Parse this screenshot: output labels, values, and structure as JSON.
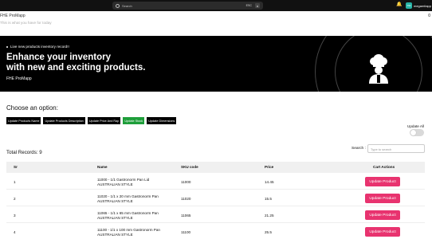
{
  "search": {
    "placeholder": "Search",
    "shortcut": "ESC",
    "clear": "x"
  },
  "user": {
    "initials": "mc",
    "name": "megamitapp"
  },
  "app": {
    "title": "FHE ProMapp",
    "subtitle": "This is what you have for today",
    "count": "0"
  },
  "banner": {
    "live": "Live new products inventory record!!",
    "headline_1": "Enhance your inventory",
    "headline_2": "with new and exciting products.",
    "brand": "FHE ProMapp"
  },
  "options": {
    "title": "Choose an option:",
    "chips": [
      "Update Products Name",
      "Update Products Description",
      "Update Price And Rap",
      "Update Stock",
      "Update Dimensions"
    ],
    "active": 3
  },
  "update_all": {
    "label": "Update All"
  },
  "table": {
    "total": "Total Records: 9",
    "search_label": "Search :",
    "search_placeholder": "Type to search",
    "headers": [
      "Sr",
      "Name",
      "SKU code",
      "Price",
      "Cart Actions"
    ],
    "rows": [
      {
        "sr": "1",
        "name": "11000 - 1/1 Gastronorm Pan Lid AUSTRALIAN STYLE",
        "sku": "11000",
        "price": "14.45",
        "action": "Update Product"
      },
      {
        "sr": "2",
        "name": "11020 - 1/1 x 20 mm Gastronorm Pan AUSTRALIAN STYLE",
        "sku": "11020",
        "price": "15.5",
        "action": "Update Product"
      },
      {
        "sr": "3",
        "name": "11065 - 1/1 x 65 mm Gastronorm Pan AUSTRALIAN STYLE",
        "sku": "11065",
        "price": "21.25",
        "action": "Update Product"
      },
      {
        "sr": "4",
        "name": "11100 - 1/1 x 100 mm Gastronorm Pan AUSTRALIAN STYLE",
        "sku": "11100",
        "price": "25.5",
        "action": "Update Product"
      }
    ]
  }
}
